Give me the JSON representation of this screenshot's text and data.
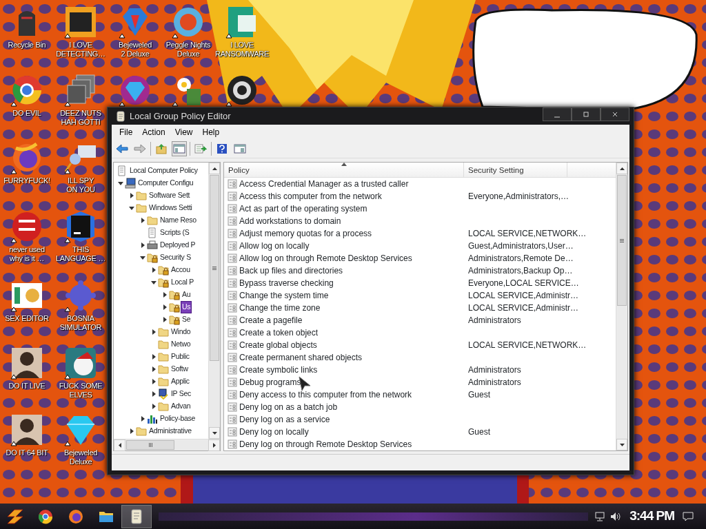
{
  "desktop_icons": [
    {
      "label": "Recycle Bin",
      "shortcut": false
    },
    {
      "label": "I LOVE DETECTING…",
      "shortcut": true
    },
    {
      "label": "Bejeweled 2 Deluxe",
      "shortcut": true
    },
    {
      "label": "Peggle Nights Deluxe",
      "shortcut": true
    },
    {
      "label": "I LOVE RANSOMWARE",
      "shortcut": true
    },
    {
      "label": "DO EVIL",
      "shortcut": true
    },
    {
      "label": "DEEZ NUTS HAH GOTTI",
      "shortcut": true
    },
    {
      "shortcut": true
    },
    {
      "shortcut": true
    },
    {
      "shortcut": true
    },
    {
      "label": "FURRYFUCK!",
      "shortcut": true
    },
    {
      "label": "ILL SPY ON YOU",
      "shortcut": true
    },
    {
      "label": "never used why is it …",
      "shortcut": true
    },
    {
      "label": "THIS LANGUAGE …",
      "shortcut": true
    },
    {
      "label": "SEX EDITOR",
      "shortcut": true
    },
    {
      "label": "BOSNIA SIMULATOR",
      "shortcut": true
    },
    {
      "label": "DO IT LIVE",
      "shortcut": true
    },
    {
      "label": "FUCK SOME ELVES",
      "shortcut": true
    },
    {
      "label": "DO IT 64 BIT",
      "shortcut": true
    },
    {
      "label": "Bejeweled Deluxe",
      "shortcut": true
    }
  ],
  "window": {
    "title": "Local Group Policy Editor",
    "menu": [
      "File",
      "Action",
      "View",
      "Help"
    ],
    "tree": [
      {
        "label": "Local Computer Policy",
        "kind": "document",
        "selected": false,
        "children": [
          {
            "label": "Computer Configu",
            "kind": "computer",
            "expanded": true,
            "selected": false,
            "children": [
              {
                "label": "Software Sett",
                "kind": "folder",
                "expanded": false,
                "selected": false
              },
              {
                "label": "Windows Setti",
                "kind": "folder",
                "expanded": true,
                "selected": false,
                "children": [
                  {
                    "label": "Name Reso",
                    "kind": "folder",
                    "expanded": false,
                    "selected": false
                  },
                  {
                    "label": "Scripts (S",
                    "kind": "document",
                    "selected": false
                  },
                  {
                    "label": "Deployed P",
                    "kind": "printer",
                    "expanded": false,
                    "selected": false
                  },
                  {
                    "label": "Security S",
                    "kind": "locked",
                    "expanded": true,
                    "selected": false,
                    "children": [
                      {
                        "label": "Accou",
                        "kind": "locked",
                        "expanded": false,
                        "selected": false
                      },
                      {
                        "label": "Local P",
                        "kind": "locked",
                        "expanded": true,
                        "selected": false,
                        "children": [
                          {
                            "label": "Au",
                            "kind": "locked",
                            "expanded": false,
                            "selected": false
                          },
                          {
                            "label": "Us",
                            "kind": "locked",
                            "expanded": false,
                            "selected": true
                          },
                          {
                            "label": "Se",
                            "kind": "locked",
                            "expanded": false,
                            "selected": false
                          }
                        ]
                      },
                      {
                        "label": "Windo",
                        "kind": "folder",
                        "expanded": false,
                        "selected": false
                      },
                      {
                        "label": "Netwo",
                        "kind": "folder",
                        "selected": false
                      },
                      {
                        "label": "Public",
                        "kind": "folder",
                        "expanded": false,
                        "selected": false
                      },
                      {
                        "label": "Softw",
                        "kind": "folder",
                        "expanded": false,
                        "selected": false
                      },
                      {
                        "label": "Applic",
                        "kind": "folder",
                        "expanded": false,
                        "selected": false
                      },
                      {
                        "label": "IP Sec",
                        "kind": "shield",
                        "expanded": false,
                        "selected": false
                      },
                      {
                        "label": "Advan",
                        "kind": "folder",
                        "expanded": false,
                        "selected": false
                      }
                    ]
                  },
                  {
                    "label": "Policy-base",
                    "kind": "chart",
                    "expanded": false,
                    "selected": false
                  }
                ]
              },
              {
                "label": "Administrative",
                "kind": "folder",
                "expanded": false,
                "selected": false
              }
            ]
          }
        ]
      }
    ],
    "columns": [
      "Policy",
      "Security Setting"
    ],
    "rows": [
      {
        "policy": "Access Credential Manager as a trusted caller",
        "setting": ""
      },
      {
        "policy": "Access this computer from the network",
        "setting": "Everyone,Administrators,…"
      },
      {
        "policy": "Act as part of the operating system",
        "setting": ""
      },
      {
        "policy": "Add workstations to domain",
        "setting": ""
      },
      {
        "policy": "Adjust memory quotas for a process",
        "setting": "LOCAL SERVICE,NETWORK…"
      },
      {
        "policy": "Allow log on locally",
        "setting": "Guest,Administrators,User…"
      },
      {
        "policy": "Allow log on through Remote Desktop Services",
        "setting": "Administrators,Remote De…"
      },
      {
        "policy": "Back up files and directories",
        "setting": "Administrators,Backup Op…"
      },
      {
        "policy": "Bypass traverse checking",
        "setting": "Everyone,LOCAL SERVICE…"
      },
      {
        "policy": "Change the system time",
        "setting": "LOCAL SERVICE,Administr…"
      },
      {
        "policy": "Change the time zone",
        "setting": "LOCAL SERVICE,Administr…"
      },
      {
        "policy": "Create a pagefile",
        "setting": "Administrators"
      },
      {
        "policy": "Create a token object",
        "setting": ""
      },
      {
        "policy": "Create global objects",
        "setting": "LOCAL SERVICE,NETWORK…"
      },
      {
        "policy": "Create permanent shared objects",
        "setting": ""
      },
      {
        "policy": "Create symbolic links",
        "setting": "Administrators"
      },
      {
        "policy": "Debug programs",
        "setting": "Administrators"
      },
      {
        "policy": "Deny access to this computer from the network",
        "setting": "Guest"
      },
      {
        "policy": "Deny log on as a batch job",
        "setting": ""
      },
      {
        "policy": "Deny log on as a service",
        "setting": ""
      },
      {
        "policy": "Deny log on locally",
        "setting": "Guest"
      },
      {
        "policy": "Deny log on through Remote Desktop Services",
        "setting": ""
      }
    ]
  },
  "taskbar": {
    "apps": [
      {
        "active": false
      },
      {
        "active": false
      },
      {
        "active": false
      },
      {
        "active": true
      }
    ],
    "time": "3:44 PM"
  }
}
